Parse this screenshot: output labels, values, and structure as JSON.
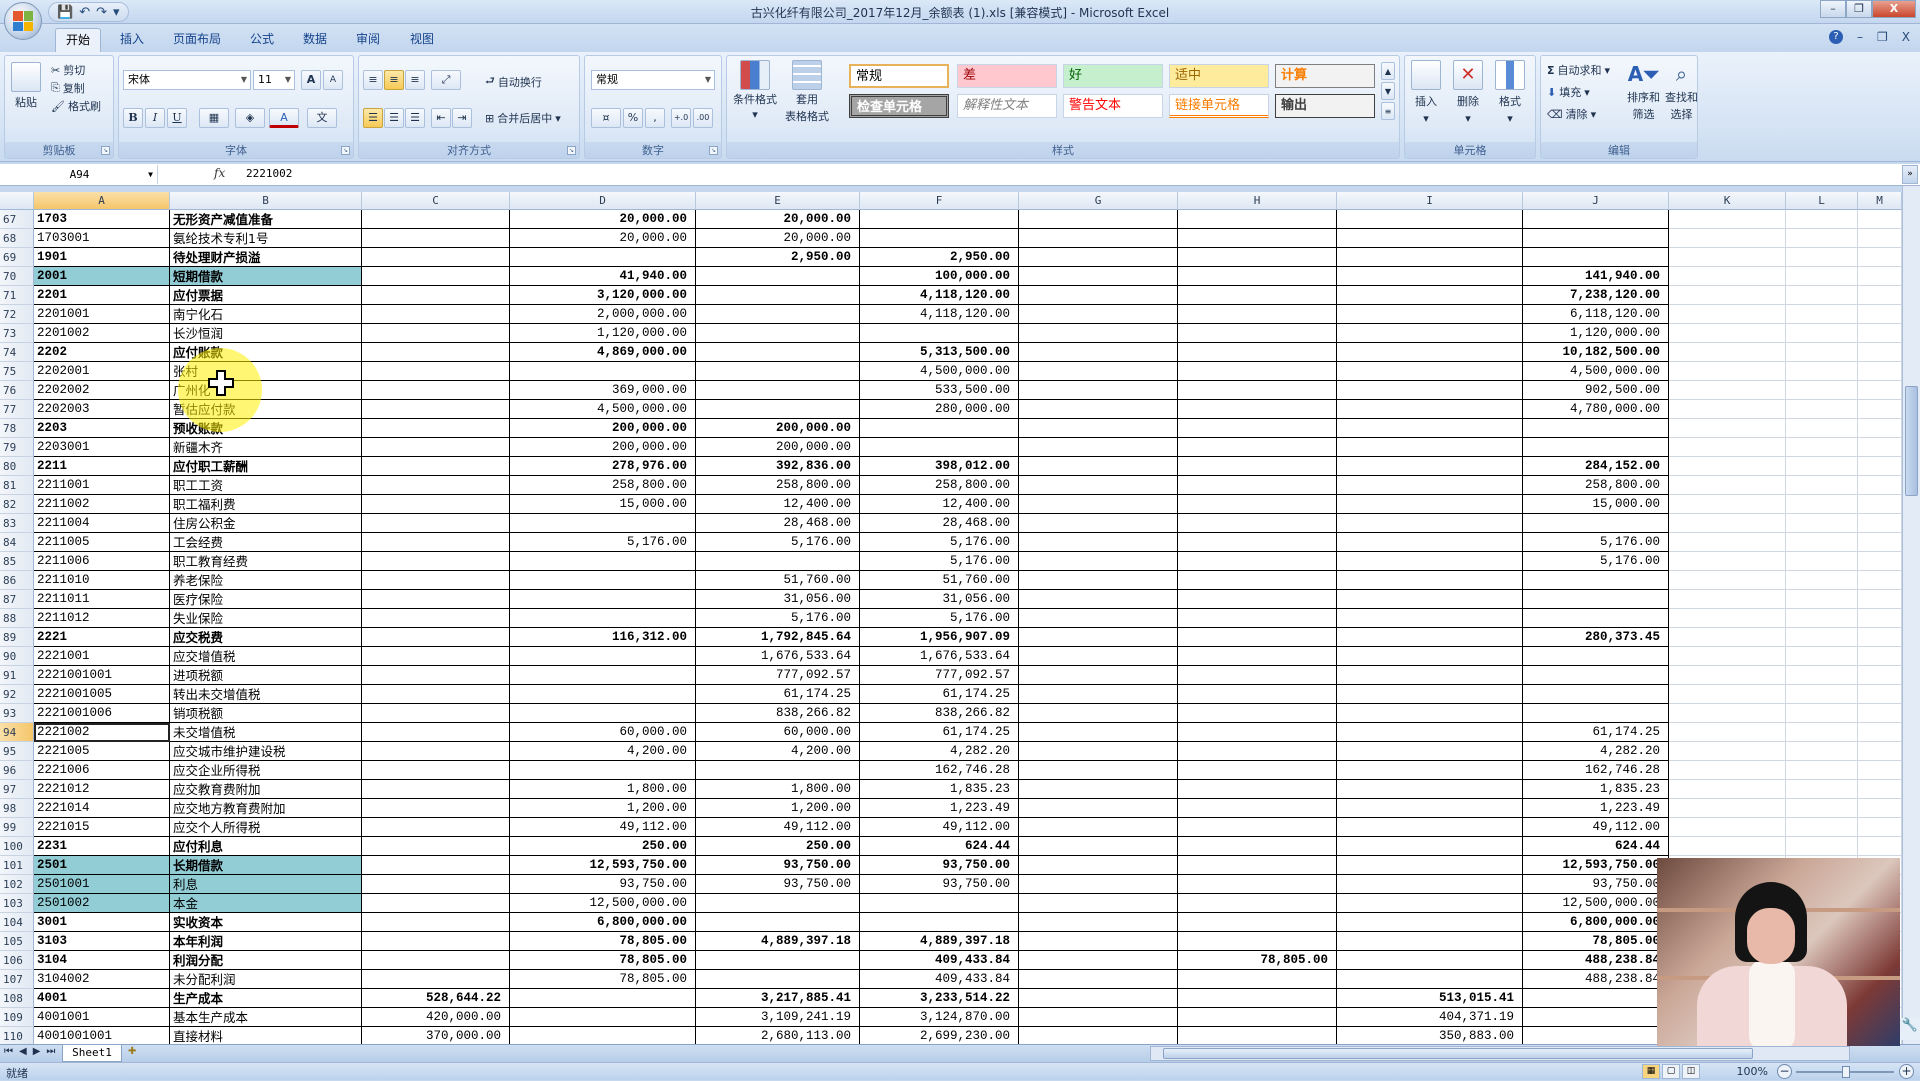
{
  "window": {
    "title": "古兴化纤有限公司_2017年12月_余额表 (1).xls  [兼容模式] - Microsoft Excel",
    "controls": {
      "minimize": "–",
      "restore": "❐",
      "close": "X"
    }
  },
  "quick_access": {
    "save_icon": "💾",
    "undo_icon": "↶",
    "redo_icon": "↷",
    "customize_icon": "▾"
  },
  "tabs": [
    {
      "label": "开始",
      "active": true
    },
    {
      "label": "插入",
      "active": false
    },
    {
      "label": "页面布局",
      "active": false
    },
    {
      "label": "公式",
      "active": false
    },
    {
      "label": "数据",
      "active": false
    },
    {
      "label": "审阅",
      "active": false
    },
    {
      "label": "视图",
      "active": false
    }
  ],
  "ribbon_help": {
    "help": "?",
    "minimize": "–",
    "restore": "❐",
    "close": "X"
  },
  "ribbon": {
    "clipboard": {
      "label": "剪贴板",
      "paste": "粘贴",
      "cut": "剪切",
      "copy": "复制",
      "format_painter": "格式刷"
    },
    "font": {
      "label": "字体",
      "font_name": "宋体",
      "font_size": "11",
      "grow": "A",
      "shrink": "A",
      "bold": "B",
      "italic": "I",
      "underline": "U",
      "font_color_bar": "#c00000"
    },
    "alignment": {
      "label": "对齐方式",
      "wrap_text": "自动换行",
      "merge_center": "合并后居中"
    },
    "number": {
      "label": "数字",
      "format": "常规",
      "percent": "%",
      "comma": ",",
      "inc_decimal": "+.0",
      "dec_decimal": ".00"
    },
    "styles": {
      "label": "样式",
      "conditional_format": "条件格式",
      "table_format_1": "套用",
      "table_format_2": "表格格式",
      "cell_styles": [
        {
          "label": "常规",
          "bg": "#ffffff",
          "color": "#000000"
        },
        {
          "label": "差",
          "bg": "#ffc7ce",
          "color": "#9c0006"
        },
        {
          "label": "好",
          "bg": "#c6efce",
          "color": "#006100"
        },
        {
          "label": "适中",
          "bg": "#ffeb9c",
          "color": "#9c6500"
        },
        {
          "label": "计算",
          "bg": "#f2f2f2",
          "color": "#fa7d00"
        },
        {
          "label": "检查单元格",
          "bg": "#a5a5a5",
          "color": "#ffffff"
        },
        {
          "label": "解释性文本",
          "bg": "#ffffff",
          "color": "#7f7f7f"
        },
        {
          "label": "警告文本",
          "bg": "#ffffff",
          "color": "#ff0000"
        },
        {
          "label": "链接单元格",
          "bg": "#ffffff",
          "color": "#fa7d00"
        },
        {
          "label": "输出",
          "bg": "#f2f2f2",
          "color": "#3f3f3f"
        }
      ]
    },
    "cells": {
      "label": "单元格",
      "insert": "插入",
      "delete": "删除",
      "format": "格式"
    },
    "editing": {
      "label": "编辑",
      "autosum": "自动求和",
      "fill": "填充",
      "clear": "清除",
      "sort_filter_1": "排序和",
      "sort_filter_2": "筛选",
      "find_select_1": "查找和",
      "find_select_2": "选择"
    }
  },
  "formula_bar": {
    "name_box": "A94",
    "fx": "fx",
    "value": "2221002"
  },
  "columns": [
    "A",
    "B",
    "C",
    "D",
    "E",
    "F",
    "G",
    "H",
    "I",
    "J",
    "K",
    "L",
    "M"
  ],
  "selected_column": "A",
  "selected_row": 94,
  "rows": [
    {
      "n": 67,
      "a": "1703",
      "b": "无形资产减值准备",
      "c": "",
      "d": "20,000.00",
      "e": "20,000.00",
      "f": "",
      "h": "",
      "i": "",
      "j": "",
      "bold": true,
      "teal": false
    },
    {
      "n": 68,
      "a": "1703001",
      "b": "氨纶技术专利1号",
      "c": "",
      "d": "20,000.00",
      "e": "20,000.00",
      "f": "",
      "h": "",
      "i": "",
      "j": "",
      "bold": false,
      "teal": false
    },
    {
      "n": 69,
      "a": "1901",
      "b": "待处理财产损溢",
      "c": "",
      "d": "",
      "e": "2,950.00",
      "f": "2,950.00",
      "h": "",
      "i": "",
      "j": "",
      "bold": true,
      "teal": false
    },
    {
      "n": 70,
      "a": "2001",
      "b": "短期借款",
      "c": "",
      "d": "41,940.00",
      "e": "",
      "f": "100,000.00",
      "h": "",
      "i": "",
      "j": "141,940.00",
      "bold": true,
      "teal": true
    },
    {
      "n": 71,
      "a": "2201",
      "b": "应付票据",
      "c": "",
      "d": "3,120,000.00",
      "e": "",
      "f": "4,118,120.00",
      "h": "",
      "i": "",
      "j": "7,238,120.00",
      "bold": true,
      "teal": false
    },
    {
      "n": 72,
      "a": "2201001",
      "b": "南宁化石",
      "c": "",
      "d": "2,000,000.00",
      "e": "",
      "f": "4,118,120.00",
      "h": "",
      "i": "",
      "j": "6,118,120.00",
      "bold": false,
      "teal": false
    },
    {
      "n": 73,
      "a": "2201002",
      "b": "长沙恒润",
      "c": "",
      "d": "1,120,000.00",
      "e": "",
      "f": "",
      "h": "",
      "i": "",
      "j": "1,120,000.00",
      "bold": false,
      "teal": false
    },
    {
      "n": 74,
      "a": "2202",
      "b": "应付账款",
      "c": "",
      "d": "4,869,000.00",
      "e": "",
      "f": "5,313,500.00",
      "h": "",
      "i": "",
      "j": "10,182,500.00",
      "bold": true,
      "teal": false
    },
    {
      "n": 75,
      "a": "2202001",
      "b": "张村",
      "c": "",
      "d": "",
      "e": "",
      "f": "4,500,000.00",
      "h": "",
      "i": "",
      "j": "4,500,000.00",
      "bold": false,
      "teal": false
    },
    {
      "n": 76,
      "a": "2202002",
      "b": "广州化",
      "c": "",
      "d": "369,000.00",
      "e": "",
      "f": "533,500.00",
      "h": "",
      "i": "",
      "j": "902,500.00",
      "bold": false,
      "teal": false
    },
    {
      "n": 77,
      "a": "2202003",
      "b": "暂估应付款",
      "c": "",
      "d": "4,500,000.00",
      "e": "",
      "f": "280,000.00",
      "h": "",
      "i": "",
      "j": "4,780,000.00",
      "bold": false,
      "teal": false
    },
    {
      "n": 78,
      "a": "2203",
      "b": "预收账款",
      "c": "",
      "d": "200,000.00",
      "e": "200,000.00",
      "f": "",
      "h": "",
      "i": "",
      "j": "",
      "bold": true,
      "teal": false
    },
    {
      "n": 79,
      "a": "2203001",
      "b": "新疆木齐",
      "c": "",
      "d": "200,000.00",
      "e": "200,000.00",
      "f": "",
      "h": "",
      "i": "",
      "j": "",
      "bold": false,
      "teal": false
    },
    {
      "n": 80,
      "a": "2211",
      "b": "应付职工薪酬",
      "c": "",
      "d": "278,976.00",
      "e": "392,836.00",
      "f": "398,012.00",
      "h": "",
      "i": "",
      "j": "284,152.00",
      "bold": true,
      "teal": false
    },
    {
      "n": 81,
      "a": "2211001",
      "b": "职工工资",
      "c": "",
      "d": "258,800.00",
      "e": "258,800.00",
      "f": "258,800.00",
      "h": "",
      "i": "",
      "j": "258,800.00",
      "bold": false,
      "teal": false
    },
    {
      "n": 82,
      "a": "2211002",
      "b": "职工福利费",
      "c": "",
      "d": "15,000.00",
      "e": "12,400.00",
      "f": "12,400.00",
      "h": "",
      "i": "",
      "j": "15,000.00",
      "bold": false,
      "teal": false
    },
    {
      "n": 83,
      "a": "2211004",
      "b": "住房公积金",
      "c": "",
      "d": "",
      "e": "28,468.00",
      "f": "28,468.00",
      "h": "",
      "i": "",
      "j": "",
      "bold": false,
      "teal": false
    },
    {
      "n": 84,
      "a": "2211005",
      "b": "工会经费",
      "c": "",
      "d": "5,176.00",
      "e": "5,176.00",
      "f": "5,176.00",
      "h": "",
      "i": "",
      "j": "5,176.00",
      "bold": false,
      "teal": false
    },
    {
      "n": 85,
      "a": "2211006",
      "b": "职工教育经费",
      "c": "",
      "d": "",
      "e": "",
      "f": "5,176.00",
      "h": "",
      "i": "",
      "j": "5,176.00",
      "bold": false,
      "teal": false
    },
    {
      "n": 86,
      "a": "2211010",
      "b": "养老保险",
      "c": "",
      "d": "",
      "e": "51,760.00",
      "f": "51,760.00",
      "h": "",
      "i": "",
      "j": "",
      "bold": false,
      "teal": false
    },
    {
      "n": 87,
      "a": "2211011",
      "b": "医疗保险",
      "c": "",
      "d": "",
      "e": "31,056.00",
      "f": "31,056.00",
      "h": "",
      "i": "",
      "j": "",
      "bold": false,
      "teal": false
    },
    {
      "n": 88,
      "a": "2211012",
      "b": "失业保险",
      "c": "",
      "d": "",
      "e": "5,176.00",
      "f": "5,176.00",
      "h": "",
      "i": "",
      "j": "",
      "bold": false,
      "teal": false
    },
    {
      "n": 89,
      "a": "2221",
      "b": "应交税费",
      "c": "",
      "d": "116,312.00",
      "e": "1,792,845.64",
      "f": "1,956,907.09",
      "h": "",
      "i": "",
      "j": "280,373.45",
      "bold": true,
      "teal": false
    },
    {
      "n": 90,
      "a": "2221001",
      "b": "应交增值税",
      "c": "",
      "d": "",
      "e": "1,676,533.64",
      "f": "1,676,533.64",
      "h": "",
      "i": "",
      "j": "",
      "bold": false,
      "teal": false
    },
    {
      "n": 91,
      "a": "2221001001",
      "b": "进项税额",
      "c": "",
      "d": "",
      "e": "777,092.57",
      "f": "777,092.57",
      "h": "",
      "i": "",
      "j": "",
      "bold": false,
      "teal": false
    },
    {
      "n": 92,
      "a": "2221001005",
      "b": "转出未交增值税",
      "c": "",
      "d": "",
      "e": "61,174.25",
      "f": "61,174.25",
      "h": "",
      "i": "",
      "j": "",
      "bold": false,
      "teal": false
    },
    {
      "n": 93,
      "a": "2221001006",
      "b": "销项税额",
      "c": "",
      "d": "",
      "e": "838,266.82",
      "f": "838,266.82",
      "h": "",
      "i": "",
      "j": "",
      "bold": false,
      "teal": false
    },
    {
      "n": 94,
      "a": "2221002",
      "b": "未交增值税",
      "c": "",
      "d": "60,000.00",
      "e": "60,000.00",
      "f": "61,174.25",
      "h": "",
      "i": "",
      "j": "61,174.25",
      "bold": false,
      "teal": false
    },
    {
      "n": 95,
      "a": "2221005",
      "b": "应交城市维护建设税",
      "c": "",
      "d": "4,200.00",
      "e": "4,200.00",
      "f": "4,282.20",
      "h": "",
      "i": "",
      "j": "4,282.20",
      "bold": false,
      "teal": false
    },
    {
      "n": 96,
      "a": "2221006",
      "b": "应交企业所得税",
      "c": "",
      "d": "",
      "e": "",
      "f": "162,746.28",
      "h": "",
      "i": "",
      "j": "162,746.28",
      "bold": false,
      "teal": false
    },
    {
      "n": 97,
      "a": "2221012",
      "b": "应交教育费附加",
      "c": "",
      "d": "1,800.00",
      "e": "1,800.00",
      "f": "1,835.23",
      "h": "",
      "i": "",
      "j": "1,835.23",
      "bold": false,
      "teal": false
    },
    {
      "n": 98,
      "a": "2221014",
      "b": "应交地方教育费附加",
      "c": "",
      "d": "1,200.00",
      "e": "1,200.00",
      "f": "1,223.49",
      "h": "",
      "i": "",
      "j": "1,223.49",
      "bold": false,
      "teal": false
    },
    {
      "n": 99,
      "a": "2221015",
      "b": "应交个人所得税",
      "c": "",
      "d": "49,112.00",
      "e": "49,112.00",
      "f": "49,112.00",
      "h": "",
      "i": "",
      "j": "49,112.00",
      "bold": false,
      "teal": false
    },
    {
      "n": 100,
      "a": "2231",
      "b": "应付利息",
      "c": "",
      "d": "250.00",
      "e": "250.00",
      "f": "624.44",
      "h": "",
      "i": "",
      "j": "624.44",
      "bold": true,
      "teal": false
    },
    {
      "n": 101,
      "a": "2501",
      "b": "长期借款",
      "c": "",
      "d": "12,593,750.00",
      "e": "93,750.00",
      "f": "93,750.00",
      "h": "",
      "i": "",
      "j": "12,593,750.00",
      "bold": true,
      "teal": true
    },
    {
      "n": 102,
      "a": "2501001",
      "b": "利息",
      "c": "",
      "d": "93,750.00",
      "e": "93,750.00",
      "f": "93,750.00",
      "h": "",
      "i": "",
      "j": "93,750.00",
      "bold": false,
      "teal": true
    },
    {
      "n": 103,
      "a": "2501002",
      "b": "本金",
      "c": "",
      "d": "12,500,000.00",
      "e": "",
      "f": "",
      "h": "",
      "i": "",
      "j": "12,500,000.00",
      "bold": false,
      "teal": true
    },
    {
      "n": 104,
      "a": "3001",
      "b": "实收资本",
      "c": "",
      "d": "6,800,000.00",
      "e": "",
      "f": "",
      "h": "",
      "i": "",
      "j": "6,800,000.00",
      "bold": true,
      "teal": false
    },
    {
      "n": 105,
      "a": "3103",
      "b": "本年利润",
      "c": "",
      "d": "78,805.00",
      "e": "4,889,397.18",
      "f": "4,889,397.18",
      "h": "",
      "i": "",
      "j": "78,805.00",
      "bold": true,
      "teal": false
    },
    {
      "n": 106,
      "a": "3104",
      "b": "利润分配",
      "c": "",
      "d": "78,805.00",
      "e": "",
      "f": "409,433.84",
      "h": "78,805.00",
      "i": "",
      "j": "488,238.84",
      "bold": true,
      "teal": false
    },
    {
      "n": 107,
      "a": "3104002",
      "b": "未分配利润",
      "c": "",
      "d": "78,805.00",
      "e": "",
      "f": "409,433.84",
      "h": "",
      "i": "",
      "j": "488,238.84",
      "bold": false,
      "teal": false
    },
    {
      "n": 108,
      "a": "4001",
      "b": "生产成本",
      "c": "528,644.22",
      "d": "",
      "e": "3,217,885.41",
      "f": "3,233,514.22",
      "h": "",
      "i": "513,015.41",
      "j": "",
      "bold": true,
      "teal": false
    },
    {
      "n": 109,
      "a": "4001001",
      "b": "基本生产成本",
      "c": "420,000.00",
      "d": "",
      "e": "3,109,241.19",
      "f": "3,124,870.00",
      "h": "",
      "i": "404,371.19",
      "j": "",
      "bold": false,
      "teal": false
    },
    {
      "n": 110,
      "a": "4001001001",
      "b": "直接材料",
      "c": "370,000.00",
      "d": "",
      "e": "2,680,113.00",
      "f": "2,699,230.00",
      "h": "",
      "i": "350,883.00",
      "j": "",
      "bold": false,
      "teal": false
    }
  ],
  "sheet_tabs": [
    {
      "label": "Sheet1",
      "active": true
    }
  ],
  "status": {
    "text": "就绪",
    "zoom": "100%"
  }
}
